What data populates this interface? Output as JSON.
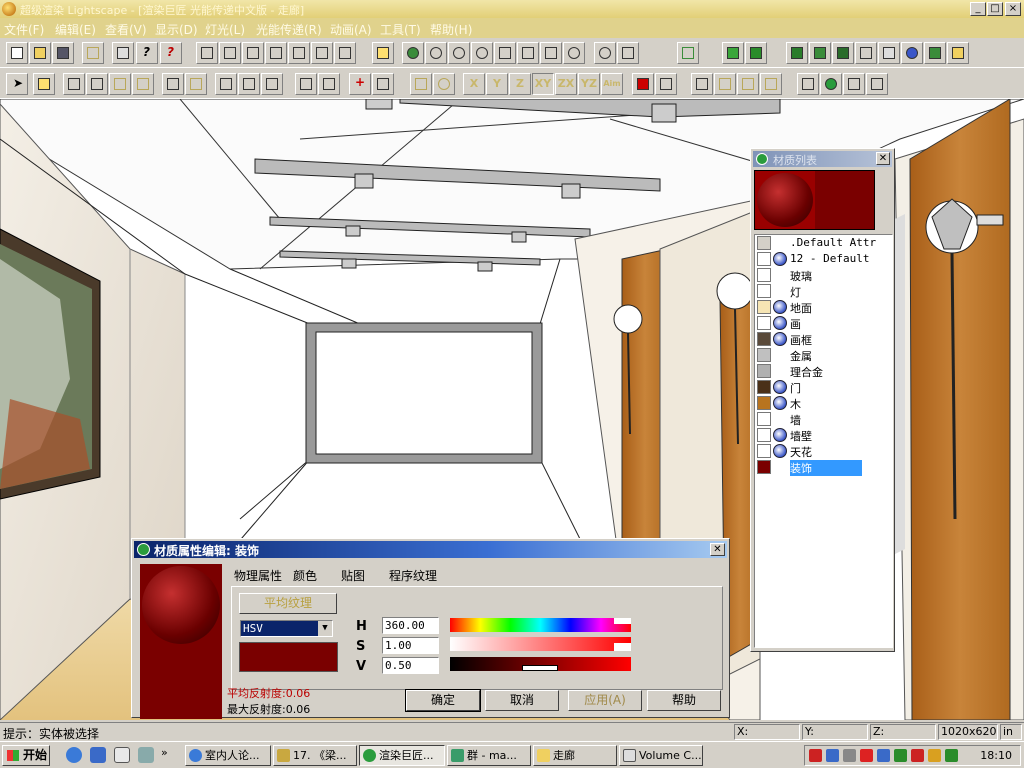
{
  "window": {
    "title": "超级渲染 Lightscape - [渲染巨匠 光能传递中文版 - 走廊]",
    "controls": [
      "_",
      "□",
      "×"
    ]
  },
  "menu": [
    "文件(F)",
    "编辑(E)",
    "查看(V)",
    "显示(D)",
    "灯光(L)",
    "光能传递(R)",
    "动画(A)",
    "工具(T)",
    "帮助(H)"
  ],
  "toolbar": {
    "axis_buttons": [
      "X",
      "Y",
      "Z",
      "XY",
      "ZX",
      "YZ",
      "Aim"
    ]
  },
  "material_panel": {
    "title": "材质列表",
    "items": [
      {
        "name": ".Default Attr",
        "swatch": "#d4d0c8",
        "textured": false,
        "selected": false
      },
      {
        "name": "12 - Default",
        "swatch": "#ffffff",
        "textured": true,
        "selected": false
      },
      {
        "name": "玻璃",
        "swatch": "#ffffff",
        "textured": false,
        "selected": false
      },
      {
        "name": "灯",
        "swatch": "#ffffff",
        "textured": false,
        "selected": false
      },
      {
        "name": "地面",
        "swatch": "#f6e5b4",
        "textured": true,
        "selected": false
      },
      {
        "name": "画",
        "swatch": "#ffffff",
        "textured": true,
        "selected": false
      },
      {
        "name": "画框",
        "swatch": "#5a4a3a",
        "textured": true,
        "selected": false
      },
      {
        "name": "金属",
        "swatch": "#c0c0c0",
        "textured": false,
        "selected": false
      },
      {
        "name": "理合金",
        "swatch": "#b0b0b0",
        "textured": false,
        "selected": false
      },
      {
        "name": "门",
        "swatch": "#4a3018",
        "textured": true,
        "selected": false
      },
      {
        "name": "木",
        "swatch": "#b8741f",
        "textured": true,
        "selected": false
      },
      {
        "name": "墙",
        "swatch": "#ffffff",
        "textured": false,
        "selected": false
      },
      {
        "name": "墙壁",
        "swatch": "#ffffff",
        "textured": true,
        "selected": false
      },
      {
        "name": "天花",
        "swatch": "#ffffff",
        "textured": true,
        "selected": false
      },
      {
        "name": "装饰",
        "swatch": "#7a0000",
        "textured": false,
        "selected": true
      }
    ]
  },
  "material_dialog": {
    "title": "材质属性编辑: 装饰",
    "tabs": [
      "物理属性",
      "颜色",
      "贴图",
      "程序纹理"
    ],
    "active_tab": "颜色",
    "average_texture_button": "平均纹理",
    "color_model": "HSV",
    "color_swatch": "#7a0000",
    "h_label": "H",
    "h_value": "360.00",
    "s_label": "S",
    "s_value": "1.00",
    "v_label": "V",
    "v_value": "0.50",
    "avg_reflectance": "平均反射度:0.06",
    "max_reflectance": "最大反射度:0.06",
    "buttons": {
      "ok": "确定",
      "cancel": "取消",
      "apply": "应用(A)",
      "help": "帮助"
    }
  },
  "status": {
    "hint": "提示：实体被选择",
    "x_label": "X:",
    "y_label": "Y:",
    "z_label": "Z:",
    "resolution": "1020x620",
    "unit": "in"
  },
  "taskbar": {
    "start": "开始",
    "tasks": [
      "室内人论...",
      "17. 《梁...",
      "渲染巨匠...",
      "群 - ma...",
      "走廊",
      "Volume C..."
    ],
    "active_task": 2,
    "clock": "18:10"
  },
  "colors": {
    "title_bar": "#e2cf77",
    "selection": "#3399ff",
    "material_color": "#7a0000",
    "wood": "#b8741f"
  }
}
